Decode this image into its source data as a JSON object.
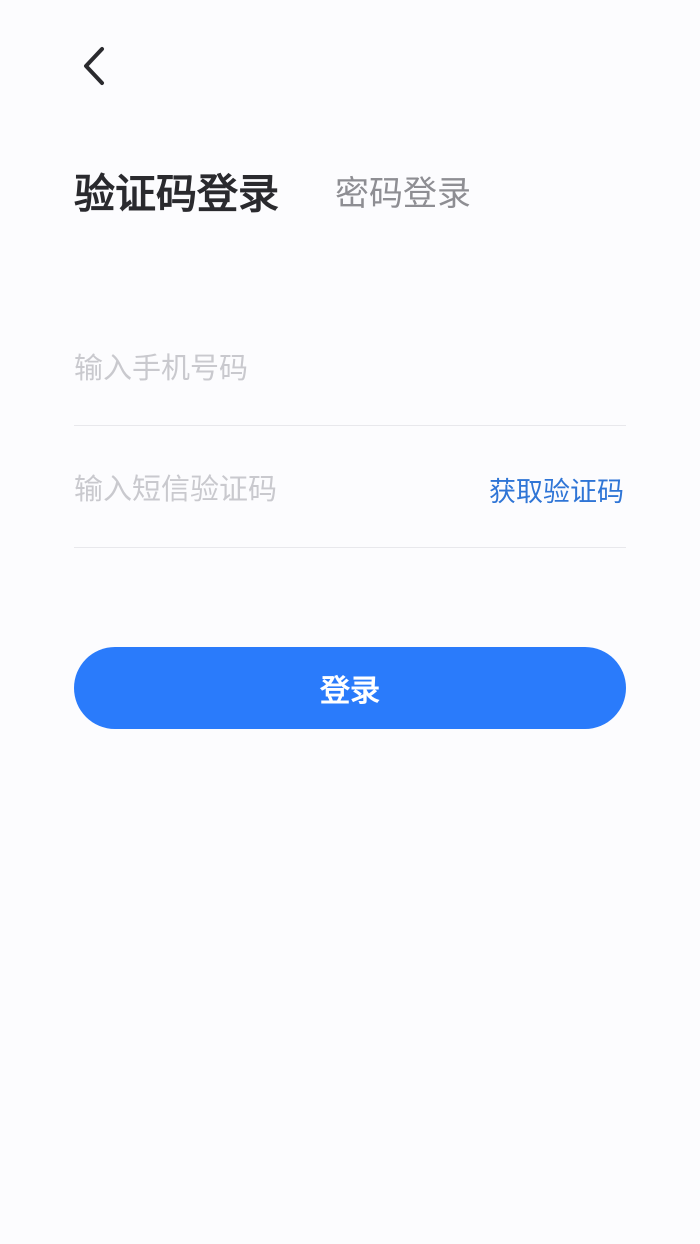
{
  "header": {
    "back_icon": "chevron-left-icon"
  },
  "tabs": [
    {
      "label": "验证码登录",
      "active": true
    },
    {
      "label": "密码登录",
      "active": false
    }
  ],
  "form": {
    "phone": {
      "value": "",
      "placeholder": "输入手机号码"
    },
    "sms_code": {
      "value": "",
      "placeholder": "输入短信验证码"
    },
    "get_code_label": "获取验证码"
  },
  "login_button": {
    "label": "登录"
  },
  "colors": {
    "background": "#fcfcfe",
    "primary": "#2a7bfb",
    "link": "#2f75d6",
    "title": "#2a2a2e",
    "inactive_tab": "#8e8e93",
    "placeholder": "#c9c9ce",
    "divider": "#e8e8ec"
  }
}
